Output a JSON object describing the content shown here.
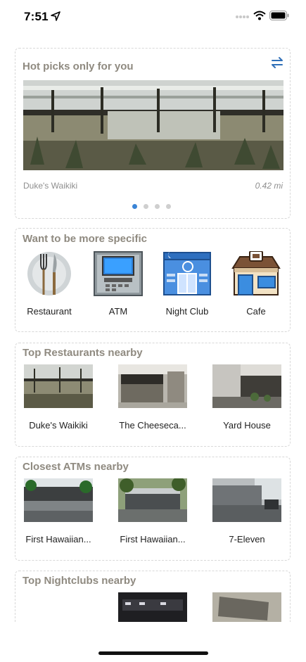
{
  "status_bar": {
    "time": "7:51"
  },
  "hot_picks": {
    "title": "Hot picks only for you",
    "caption": "Duke's Waikiki",
    "distance": "0.42 mi",
    "pages": 4,
    "active_page": 1
  },
  "categories": {
    "title": "Want to be more specific",
    "items": [
      {
        "label": "Restaurant",
        "icon": "fork-knife-plate-icon"
      },
      {
        "label": "ATM",
        "icon": "atm-machine-icon"
      },
      {
        "label": "Night Club",
        "icon": "night-club-building-icon"
      },
      {
        "label": "Cafe",
        "icon": "cafe-storefront-icon"
      }
    ]
  },
  "top_restaurants": {
    "title": "Top Restaurants nearby",
    "items": [
      {
        "label": "Duke's Waikiki"
      },
      {
        "label": "The Cheeseca..."
      },
      {
        "label": "Yard House"
      }
    ]
  },
  "closest_atms": {
    "title": "Closest ATMs nearby",
    "items": [
      {
        "label": "First Hawaiian..."
      },
      {
        "label": "First Hawaiian..."
      },
      {
        "label": "7-Eleven"
      }
    ]
  },
  "top_nightclubs": {
    "title": "Top Nightclubs nearby"
  },
  "colors": {
    "section_title": "#8f8a80",
    "page_dot_active": "#3a84d6",
    "page_dot": "#cfcfcf"
  }
}
